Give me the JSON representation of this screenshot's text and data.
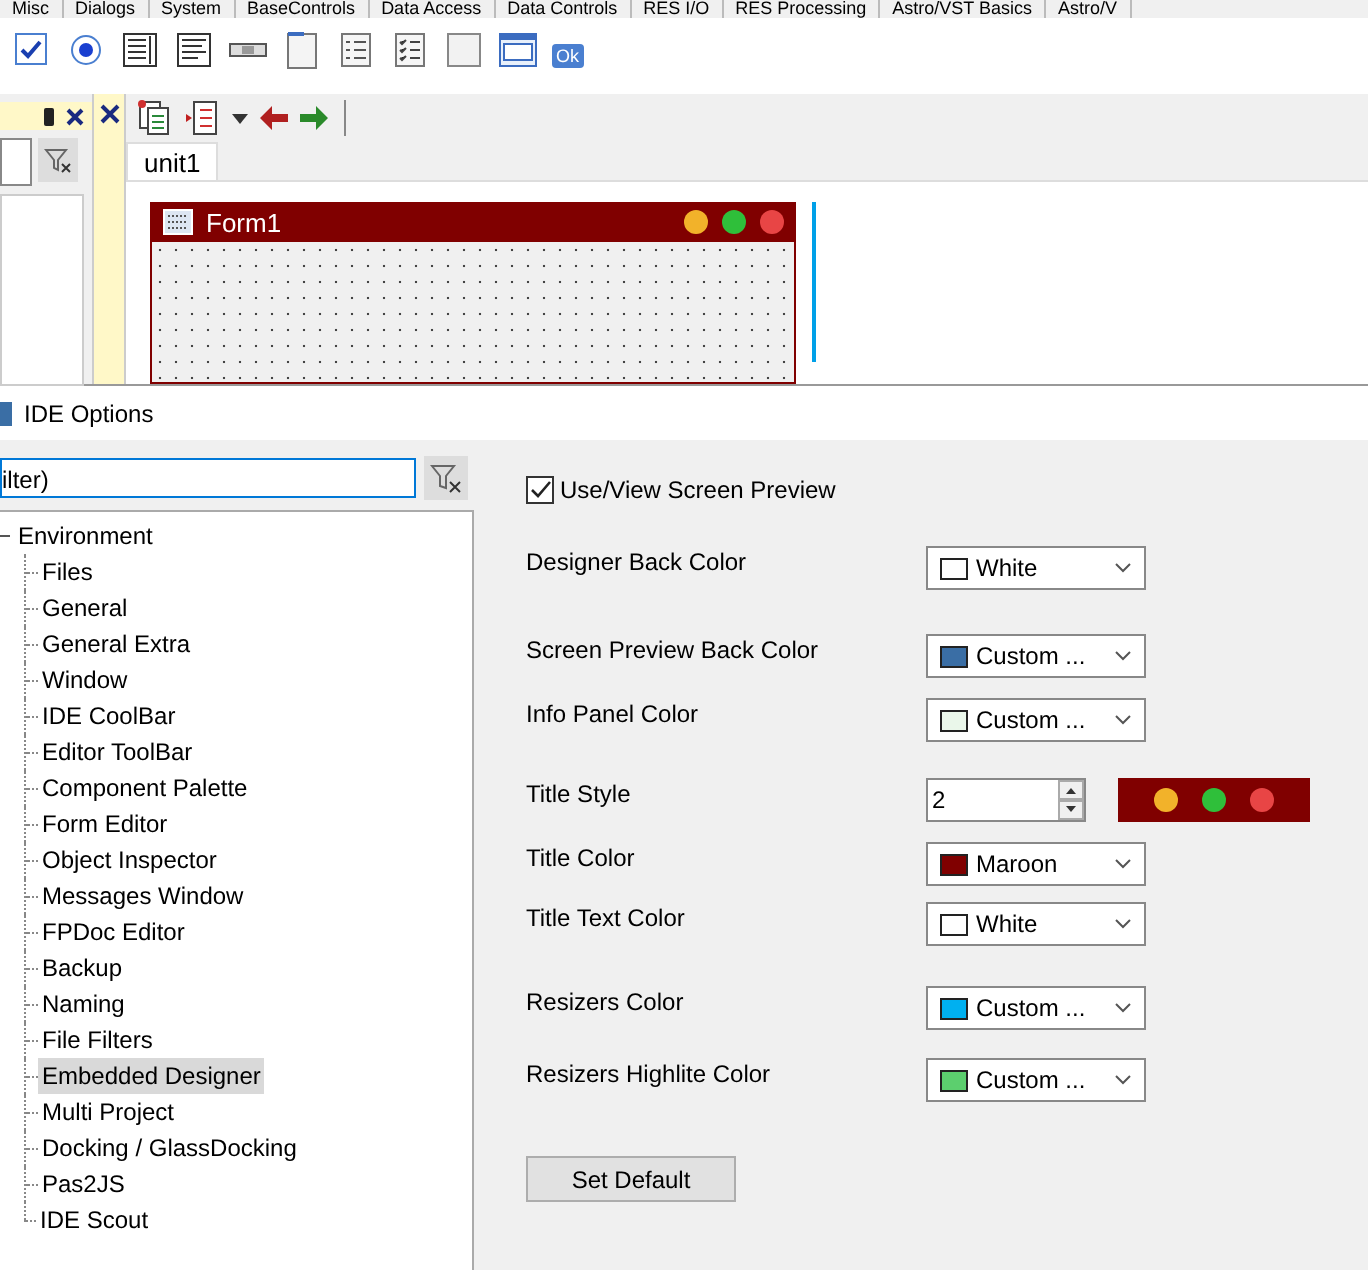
{
  "palette_tabs": [
    {
      "label": "Misc",
      "selected": false
    },
    {
      "label": "Dialogs",
      "selected": false
    },
    {
      "label": "System",
      "selected": false
    },
    {
      "label": "BaseControls",
      "selected": false
    },
    {
      "label": "Data Access",
      "selected": false
    },
    {
      "label": "Data Controls",
      "selected": false
    },
    {
      "label": "RES I/O",
      "selected": false
    },
    {
      "label": "RES Processing",
      "selected": false
    },
    {
      "label": "Astro/VST Basics",
      "selected": false
    },
    {
      "label": "Astro/V",
      "selected": false
    }
  ],
  "ok_icon_caption": "Ok",
  "editor": {
    "tabs": [
      {
        "label": "unit1",
        "selected": true
      }
    ],
    "form": {
      "title": "Form1"
    }
  },
  "options": {
    "title": "IDE Options",
    "filter": {
      "value": "ilter)"
    },
    "tree": [
      {
        "label": "Environment",
        "expanded": true,
        "selected": false,
        "children": [
          {
            "label": "Files",
            "selected": false
          },
          {
            "label": "General",
            "selected": false
          },
          {
            "label": "General Extra",
            "selected": false
          },
          {
            "label": "Window",
            "selected": false
          },
          {
            "label": "IDE CoolBar",
            "selected": false
          },
          {
            "label": "Editor ToolBar",
            "selected": false
          },
          {
            "label": "Component Palette",
            "selected": false
          },
          {
            "label": "Form Editor",
            "selected": false
          },
          {
            "label": "Object Inspector",
            "selected": false
          },
          {
            "label": "Messages Window",
            "selected": false
          },
          {
            "label": "FPDoc Editor",
            "selected": false
          },
          {
            "label": "Backup",
            "selected": false
          },
          {
            "label": "Naming",
            "selected": false
          },
          {
            "label": "File Filters",
            "selected": false
          },
          {
            "label": "Embedded Designer",
            "selected": true
          },
          {
            "label": "Multi Project",
            "selected": false
          },
          {
            "label": "Docking / GlassDocking",
            "selected": false
          },
          {
            "label": "Pas2JS",
            "selected": false
          },
          {
            "label": "IDE Scout",
            "selected": false
          }
        ]
      }
    ],
    "preview_checkbox": {
      "label": "Use/View Screen Preview",
      "checked": true
    },
    "settings": [
      {
        "kind": "color",
        "label": "Designer Back Color",
        "value": "White",
        "color": "#ffffff"
      },
      {
        "kind": "color",
        "label": "Screen Preview Back Color",
        "value": "Custom ...",
        "color": "#3a6ea5"
      },
      {
        "kind": "color",
        "label": "Info Panel Color",
        "value": "Custom ...",
        "color": "#eaf7ea"
      },
      {
        "kind": "spin",
        "label": "Title Style",
        "value": "2"
      },
      {
        "kind": "color",
        "label": "Title Color",
        "value": "Maroon",
        "color": "#800000"
      },
      {
        "kind": "color",
        "label": "Title Text Color",
        "value": "White",
        "color": "#ffffff"
      },
      {
        "kind": "color",
        "label": "Resizers Color",
        "value": "Custom ...",
        "color": "#00b0f0"
      },
      {
        "kind": "color",
        "label": "Resizers Highlite Color",
        "value": "Custom ...",
        "color": "#5ccf6e"
      }
    ],
    "default_button": "Set Default"
  }
}
